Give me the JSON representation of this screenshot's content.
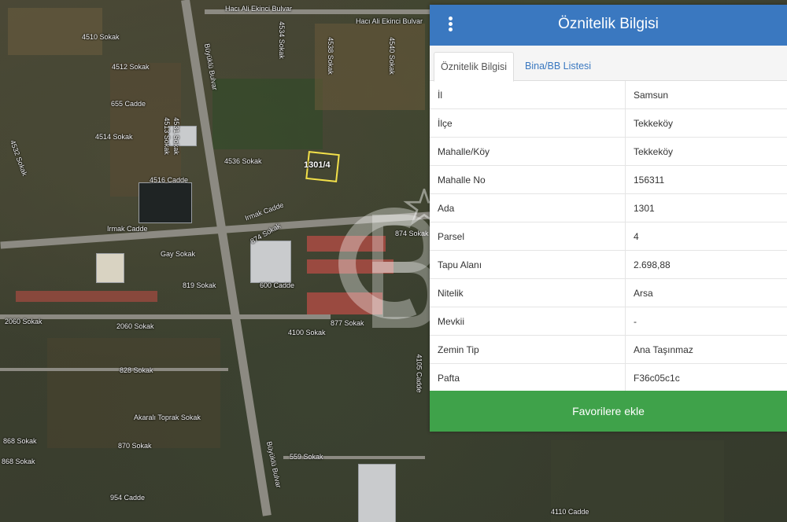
{
  "map": {
    "streets": [
      "Hacı Ali Ekinci Bulvar",
      "Hacı Ali Ekinci Bulvar",
      "4510 Sokak",
      "4512 Sokak",
      "655 Cadde",
      "4514 Sokak",
      "4534 Sokak",
      "4538 Sokak",
      "4540 Sokak",
      "4536 Sokak",
      "4516 Cadde",
      "Büyüklü Bulvar",
      "Irmak Cadde",
      "Irmak Cadde",
      "4513 Sokak",
      "874 Sokak",
      "874 Sokak",
      "Gay Sokak",
      "819 Sokak",
      "600 Cadde",
      "2060 Sokak",
      "2060 Sokak",
      "877 Sokak",
      "4100 Sokak",
      "828 Sokak",
      "4105 Cadde",
      "Akaralı Toprak Sokak",
      "870 Sokak",
      "868 Sokak",
      "868 Sokak",
      "559 Sokak",
      "954 Cadde",
      "Büyüklü Bulvar",
      "4110 Cadde",
      "4532 Sokak",
      "4531 Sokak"
    ],
    "parcel_label": "1301/4"
  },
  "panel": {
    "title": "Öznitelik Bilgisi",
    "tabs": [
      "Öznitelik Bilgisi",
      "Bina/BB Listesi"
    ],
    "rows": [
      {
        "key": "İl",
        "value": "Samsun"
      },
      {
        "key": "İlçe",
        "value": "Tekkeköy"
      },
      {
        "key": "Mahalle/Köy",
        "value": "Tekkeköy"
      },
      {
        "key": "Mahalle No",
        "value": "156311"
      },
      {
        "key": "Ada",
        "value": "1301"
      },
      {
        "key": "Parsel",
        "value": "4"
      },
      {
        "key": "Tapu Alanı",
        "value": "2.698,88"
      },
      {
        "key": "Nitelik",
        "value": "Arsa"
      },
      {
        "key": "Mevkii",
        "value": "-"
      },
      {
        "key": "Zemin Tip",
        "value": "Ana Taşınmaz"
      },
      {
        "key": "Pafta",
        "value": "F36c05c1c"
      }
    ],
    "favorite_button": "Favorilere ekle"
  },
  "colors": {
    "header": "#3a78c0",
    "button": "#3fa24a"
  }
}
